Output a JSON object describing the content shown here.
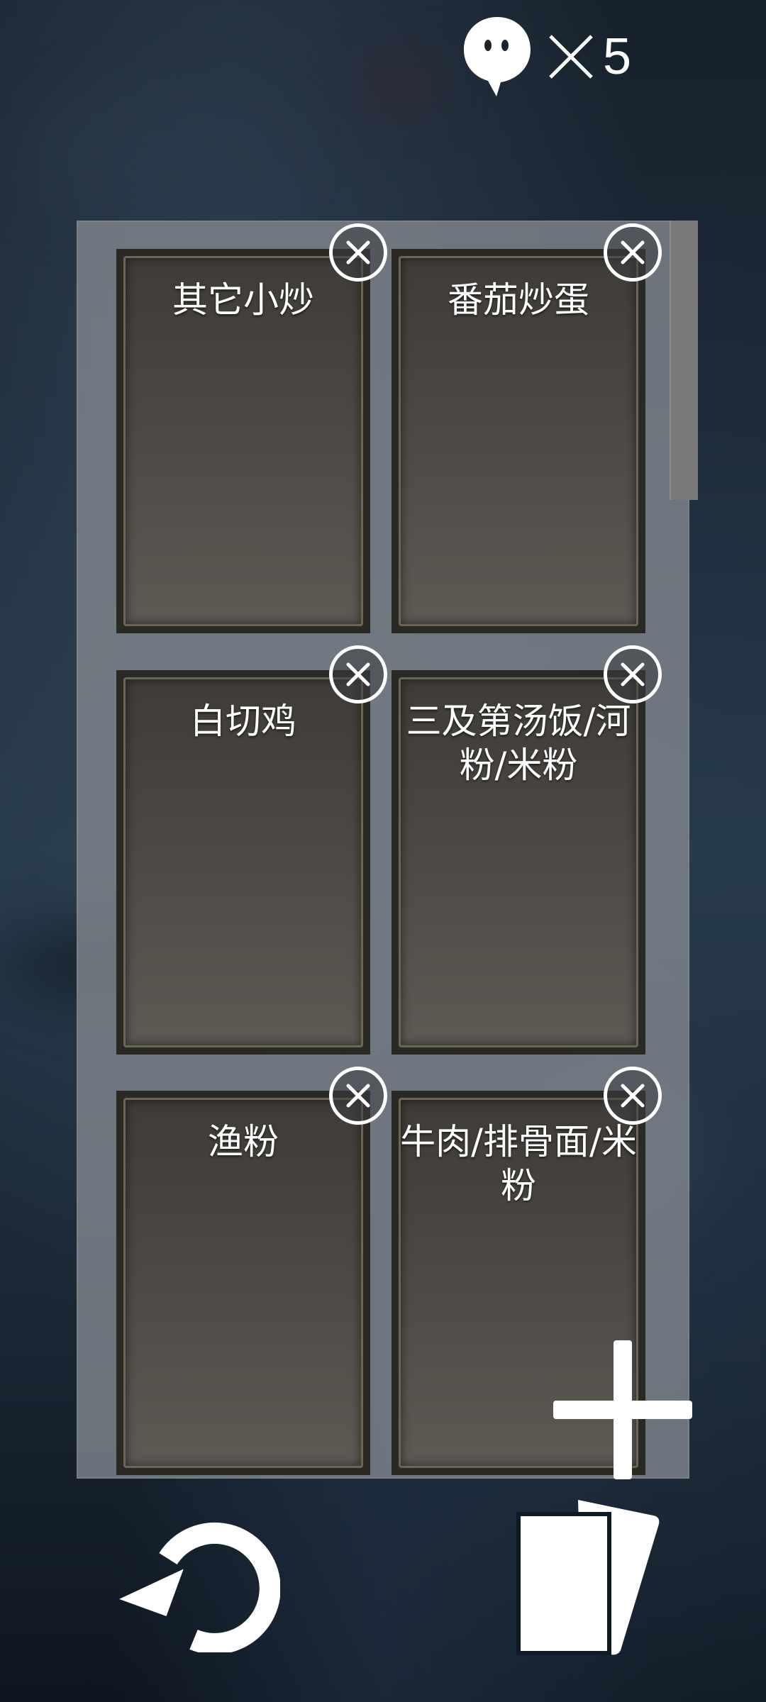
{
  "hud": {
    "lives_icon": "ghost-speech-bubble-icon",
    "multiplier_icon": "times-icon",
    "lives_count": "5"
  },
  "board": {
    "cards": [
      {
        "title": "其它小炒"
      },
      {
        "title": "番茄炒蛋"
      },
      {
        "title": "白切鸡"
      },
      {
        "title": "三及第汤饭/河粉/米粉"
      },
      {
        "title": "渔粉"
      },
      {
        "title": "牛肉/排骨面/米粉"
      }
    ],
    "remove_icon": "close-circle-icon"
  },
  "controls": {
    "add_icon": "plus-icon",
    "undo_icon": "undo-icon",
    "deck_icon": "cards-icon"
  },
  "colors": {
    "panel": "#80858c",
    "card_face": "#4a4742",
    "card_border": "#6a6656",
    "icon": "#ffffff"
  }
}
